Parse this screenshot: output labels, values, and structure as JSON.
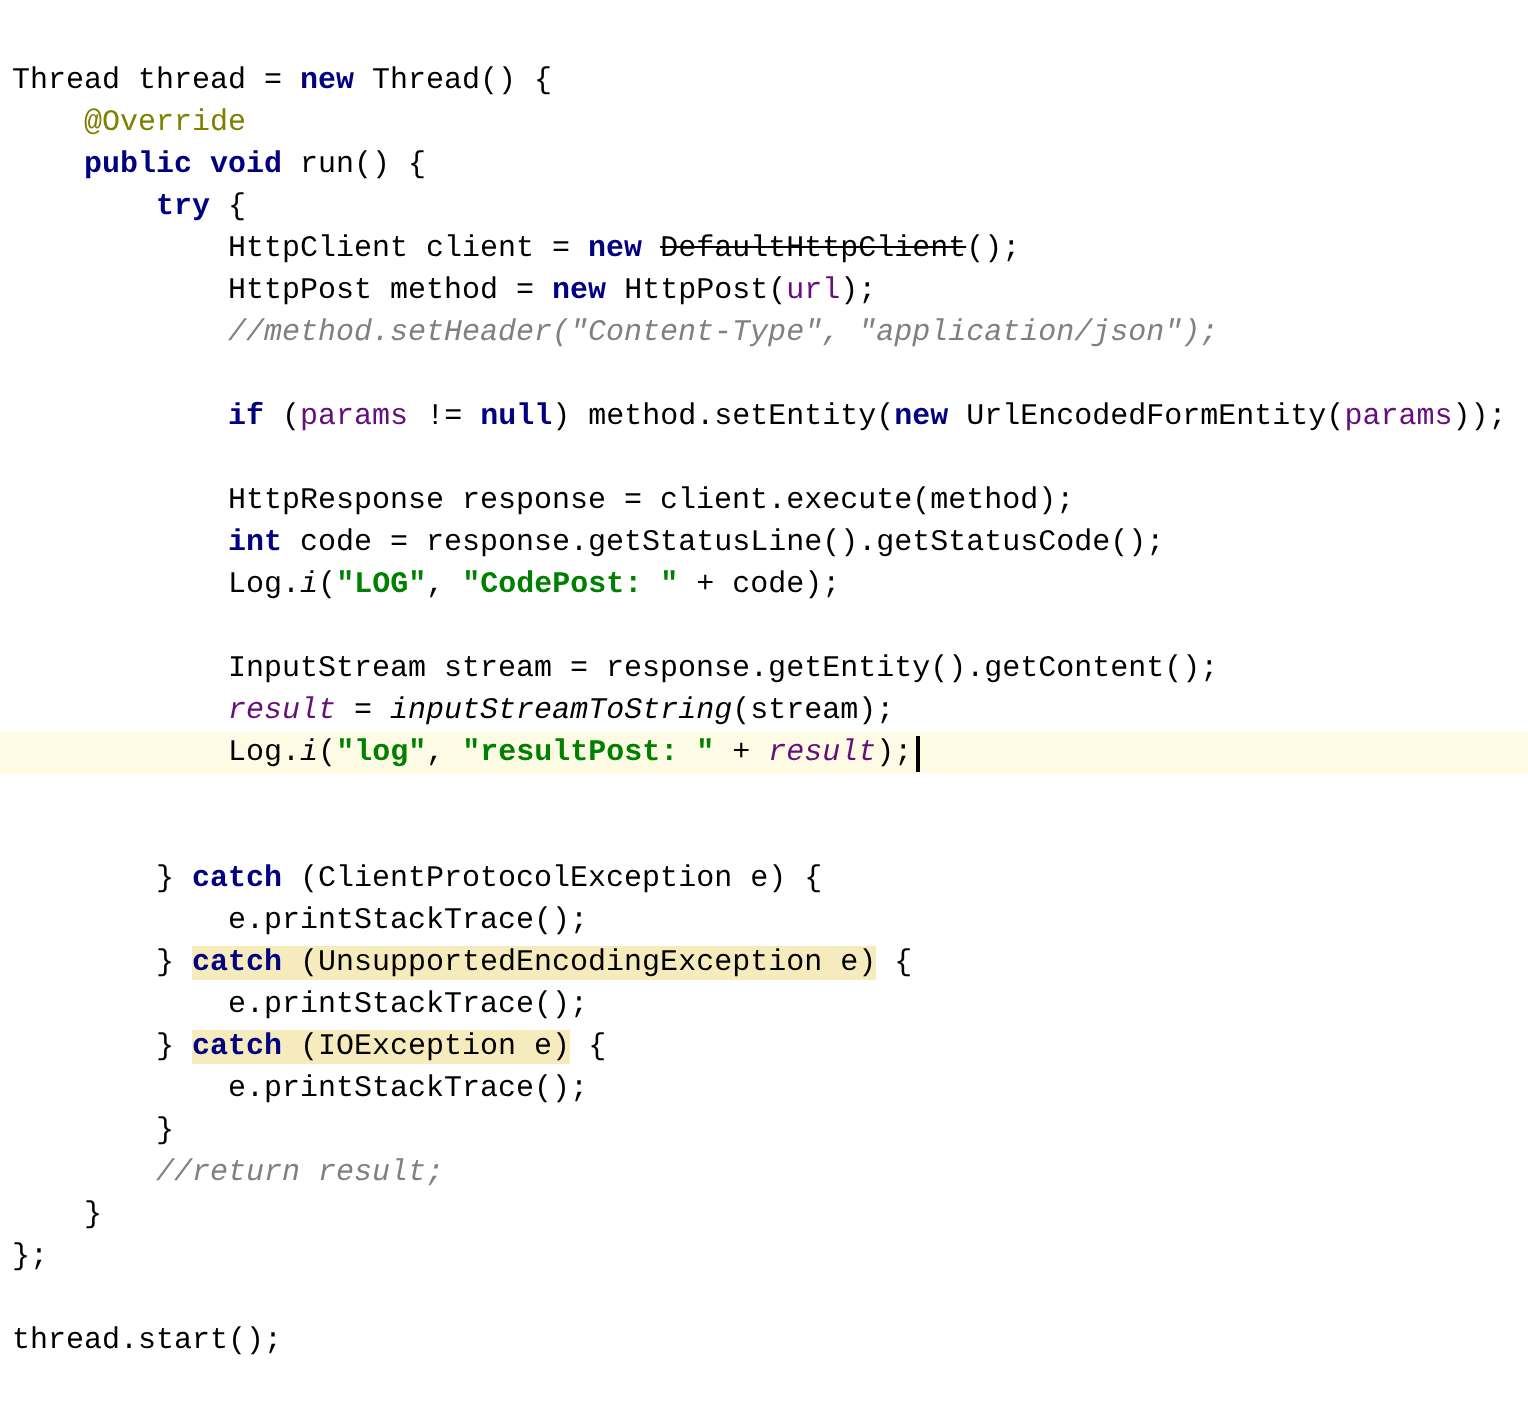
{
  "editor": {
    "lines": [
      {
        "kind": "code",
        "tokens": [
          {
            "text": "Thread thread = ",
            "kind": "plain"
          },
          {
            "text": "new",
            "kind": "keyword"
          },
          {
            "text": " Thread() {",
            "kind": "plain"
          }
        ]
      },
      {
        "kind": "code",
        "tokens": [
          {
            "text": "    @Override",
            "kind": "annotation"
          }
        ]
      },
      {
        "kind": "code",
        "tokens": [
          {
            "text": "    public void",
            "kind": "keyword"
          },
          {
            "text": " run() {",
            "kind": "plain"
          }
        ]
      },
      {
        "kind": "code",
        "tokens": [
          {
            "text": "        try",
            "kind": "keyword"
          },
          {
            "text": " {",
            "kind": "plain"
          }
        ]
      },
      {
        "kind": "code",
        "tokens": [
          {
            "text": "            HttpClient client = ",
            "kind": "plain"
          },
          {
            "text": "new ",
            "kind": "keyword"
          },
          {
            "text": "DefaultHttpClient",
            "kind": "deprecated"
          },
          {
            "text": "();",
            "kind": "plain"
          }
        ]
      },
      {
        "kind": "code",
        "tokens": [
          {
            "text": "            HttpPost method = ",
            "kind": "plain"
          },
          {
            "text": "new",
            "kind": "keyword"
          },
          {
            "text": " HttpPost(",
            "kind": "plain"
          },
          {
            "text": "url",
            "kind": "variable"
          },
          {
            "text": ");",
            "kind": "plain"
          }
        ]
      },
      {
        "kind": "code",
        "tokens": [
          {
            "text": "            //method.setHeader(\"Content-Type\", \"application/json\");",
            "kind": "comment"
          }
        ]
      },
      {
        "kind": "blank"
      },
      {
        "kind": "code",
        "tokens": [
          {
            "text": "            if",
            "kind": "keyword"
          },
          {
            "text": " (",
            "kind": "plain"
          },
          {
            "text": "params",
            "kind": "variable"
          },
          {
            "text": " != ",
            "kind": "plain"
          },
          {
            "text": "null",
            "kind": "keyword"
          },
          {
            "text": ") method.setEntity(",
            "kind": "plain"
          },
          {
            "text": "new",
            "kind": "keyword"
          },
          {
            "text": " UrlEncodedFormEntity(",
            "kind": "plain"
          },
          {
            "text": "params",
            "kind": "variable"
          },
          {
            "text": "));",
            "kind": "plain"
          }
        ]
      },
      {
        "kind": "blank"
      },
      {
        "kind": "code",
        "tokens": [
          {
            "text": "            HttpResponse response = client.execute(method);",
            "kind": "plain"
          }
        ]
      },
      {
        "kind": "code",
        "tokens": [
          {
            "text": "            int",
            "kind": "keyword"
          },
          {
            "text": " code = response.getStatusLine().getStatusCode();",
            "kind": "plain"
          }
        ]
      },
      {
        "kind": "code",
        "tokens": [
          {
            "text": "            Log.",
            "kind": "plain"
          },
          {
            "text": "i",
            "kind": "static"
          },
          {
            "text": "(",
            "kind": "plain"
          },
          {
            "text": "\"LOG\"",
            "kind": "string"
          },
          {
            "text": ", ",
            "kind": "plain"
          },
          {
            "text": "\"CodePost: \"",
            "kind": "string"
          },
          {
            "text": " + code);",
            "kind": "plain"
          }
        ]
      },
      {
        "kind": "blank"
      },
      {
        "kind": "code",
        "tokens": [
          {
            "text": "            InputStream stream = response.getEntity().getContent();",
            "kind": "plain"
          }
        ]
      },
      {
        "kind": "code",
        "tokens": [
          {
            "text": "            result",
            "kind": "field"
          },
          {
            "text": " = ",
            "kind": "plain"
          },
          {
            "text": "inputStreamToString",
            "kind": "static"
          },
          {
            "text": "(stream);",
            "kind": "plain"
          }
        ]
      },
      {
        "kind": "code",
        "current": true,
        "tokens": [
          {
            "text": "            Log.",
            "kind": "plain"
          },
          {
            "text": "i",
            "kind": "static"
          },
          {
            "text": "(",
            "kind": "plain"
          },
          {
            "text": "\"log\"",
            "kind": "string"
          },
          {
            "text": ", ",
            "kind": "plain"
          },
          {
            "text": "\"resultPost: \"",
            "kind": "string"
          },
          {
            "text": " + ",
            "kind": "plain"
          },
          {
            "text": "result",
            "kind": "field"
          },
          {
            "text": ");",
            "kind": "plain"
          }
        ]
      },
      {
        "kind": "blank"
      },
      {
        "kind": "blank"
      },
      {
        "kind": "code",
        "tokens": [
          {
            "text": "        } ",
            "kind": "plain"
          },
          {
            "text": "catch",
            "kind": "keyword"
          },
          {
            "text": " (ClientProtocolException e) {",
            "kind": "plain"
          }
        ]
      },
      {
        "kind": "code",
        "tokens": [
          {
            "text": "            e.printStackTrace();",
            "kind": "plain"
          }
        ]
      },
      {
        "kind": "code",
        "tokens": [
          {
            "text": "        } ",
            "kind": "plain"
          },
          {
            "text": "catch",
            "kind": "keyword",
            "highlighted": true
          },
          {
            "text": " (UnsupportedEncodingException e)",
            "kind": "plain",
            "highlighted": true
          },
          {
            "text": " {",
            "kind": "plain"
          }
        ]
      },
      {
        "kind": "code",
        "tokens": [
          {
            "text": "            e.printStackTrace();",
            "kind": "plain"
          }
        ]
      },
      {
        "kind": "code",
        "tokens": [
          {
            "text": "        } ",
            "kind": "plain"
          },
          {
            "text": "catch",
            "kind": "keyword",
            "highlighted": true
          },
          {
            "text": " (IOException e)",
            "kind": "plain",
            "highlighted": true
          },
          {
            "text": " {",
            "kind": "plain"
          }
        ]
      },
      {
        "kind": "code",
        "tokens": [
          {
            "text": "            e.printStackTrace();",
            "kind": "plain"
          }
        ]
      },
      {
        "kind": "code",
        "tokens": [
          {
            "text": "        }",
            "kind": "plain"
          }
        ]
      },
      {
        "kind": "code",
        "tokens": [
          {
            "text": "        //return result;",
            "kind": "comment"
          }
        ]
      },
      {
        "kind": "code",
        "tokens": [
          {
            "text": "    }",
            "kind": "plain"
          }
        ]
      },
      {
        "kind": "code",
        "tokens": [
          {
            "text": "};",
            "kind": "plain"
          }
        ]
      },
      {
        "kind": "blank"
      },
      {
        "kind": "code",
        "tokens": [
          {
            "text": "thread.start();",
            "kind": "plain"
          }
        ]
      }
    ]
  }
}
